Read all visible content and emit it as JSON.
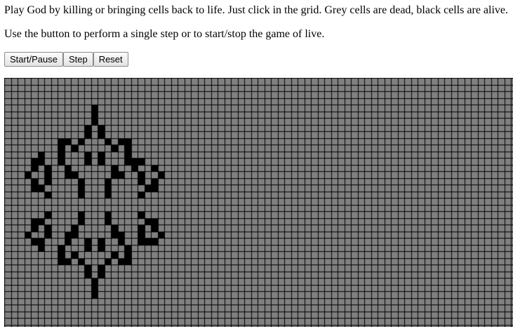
{
  "instructions": {
    "line1": "Play God by killing or bringing cells back to life. Just click in the grid. Grey cells are dead, black cells are alive.",
    "line2": "Use the button to perform a single step or to start/stop the game of live."
  },
  "controls": {
    "start_pause": "Start/Pause",
    "step": "Step",
    "reset": "Reset"
  },
  "grid": {
    "dead_color": "#808080",
    "alive_color": "#000000",
    "line_color": "#000000",
    "live_cells": [
      [
        13,
        4
      ],
      [
        13,
        5
      ],
      [
        13,
        6
      ],
      [
        12,
        7
      ],
      [
        14,
        7
      ],
      [
        12,
        8
      ],
      [
        14,
        8
      ],
      [
        8,
        9
      ],
      [
        9,
        9
      ],
      [
        11,
        9
      ],
      [
        15,
        9
      ],
      [
        17,
        9
      ],
      [
        18,
        9
      ],
      [
        8,
        10
      ],
      [
        10,
        10
      ],
      [
        16,
        10
      ],
      [
        18,
        10
      ],
      [
        5,
        11
      ],
      [
        8,
        11
      ],
      [
        12,
        11
      ],
      [
        14,
        11
      ],
      [
        18,
        11
      ],
      [
        4,
        12
      ],
      [
        5,
        12
      ],
      [
        8,
        12
      ],
      [
        12,
        12
      ],
      [
        14,
        12
      ],
      [
        18,
        12
      ],
      [
        19,
        12
      ],
      [
        20,
        12
      ],
      [
        4,
        13
      ],
      [
        6,
        13
      ],
      [
        9,
        13
      ],
      [
        16,
        13
      ],
      [
        19,
        13
      ],
      [
        22,
        13
      ],
      [
        3,
        14
      ],
      [
        6,
        14
      ],
      [
        9,
        14
      ],
      [
        10,
        14
      ],
      [
        16,
        14
      ],
      [
        17,
        14
      ],
      [
        20,
        14
      ],
      [
        23,
        14
      ],
      [
        4,
        15
      ],
      [
        6,
        15
      ],
      [
        11,
        15
      ],
      [
        15,
        15
      ],
      [
        20,
        15
      ],
      [
        22,
        15
      ],
      [
        4,
        16
      ],
      [
        5,
        16
      ],
      [
        11,
        16
      ],
      [
        15,
        16
      ],
      [
        21,
        16
      ],
      [
        22,
        16
      ],
      [
        6,
        17
      ],
      [
        11,
        17
      ],
      [
        15,
        17
      ],
      [
        20,
        17
      ],
      [
        6,
        20
      ],
      [
        11,
        20
      ],
      [
        15,
        20
      ],
      [
        20,
        20
      ],
      [
        4,
        21
      ],
      [
        5,
        21
      ],
      [
        11,
        21
      ],
      [
        15,
        21
      ],
      [
        21,
        21
      ],
      [
        22,
        21
      ],
      [
        4,
        22
      ],
      [
        6,
        22
      ],
      [
        10,
        22
      ],
      [
        16,
        22
      ],
      [
        20,
        22
      ],
      [
        22,
        22
      ],
      [
        3,
        23
      ],
      [
        6,
        23
      ],
      [
        9,
        23
      ],
      [
        10,
        23
      ],
      [
        16,
        23
      ],
      [
        17,
        23
      ],
      [
        20,
        23
      ],
      [
        23,
        23
      ],
      [
        4,
        24
      ],
      [
        5,
        24
      ],
      [
        9,
        24
      ],
      [
        12,
        24
      ],
      [
        14,
        24
      ],
      [
        17,
        24
      ],
      [
        20,
        24
      ],
      [
        21,
        24
      ],
      [
        22,
        24
      ],
      [
        5,
        25
      ],
      [
        8,
        25
      ],
      [
        12,
        25
      ],
      [
        14,
        25
      ],
      [
        18,
        25
      ],
      [
        8,
        26
      ],
      [
        10,
        26
      ],
      [
        16,
        26
      ],
      [
        18,
        26
      ],
      [
        8,
        27
      ],
      [
        9,
        27
      ],
      [
        11,
        27
      ],
      [
        15,
        27
      ],
      [
        17,
        27
      ],
      [
        18,
        27
      ],
      [
        12,
        28
      ],
      [
        14,
        28
      ],
      [
        12,
        29
      ],
      [
        14,
        29
      ],
      [
        13,
        30
      ],
      [
        13,
        31
      ],
      [
        13,
        32
      ]
    ]
  }
}
